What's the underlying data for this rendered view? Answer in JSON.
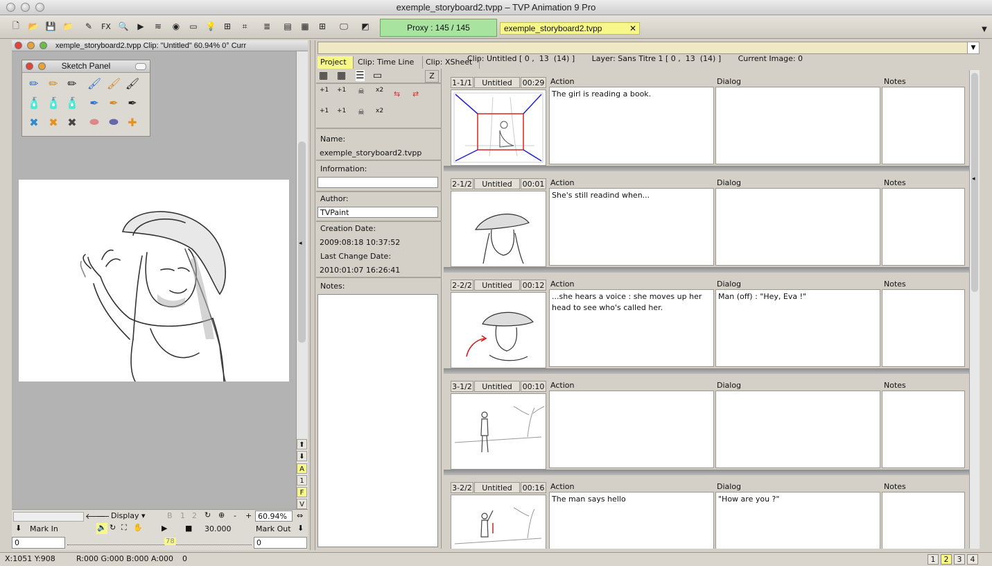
{
  "window": {
    "title": "exemple_storyboard2.tvpp – TVP Animation 9 Pro"
  },
  "toolbar": {
    "icons": [
      "new-file-icon",
      "open-folder-icon",
      "save-icon",
      "folder-icon",
      "brushes-icon",
      "fx-icon",
      "zoom-icon",
      "play-icon",
      "layers-icon",
      "color-wheel-icon",
      "palette-icon",
      "light-icon",
      "grid-icon",
      "crop-icon",
      "layer-stack-icon",
      "view1-icon",
      "view2-icon",
      "view3-icon",
      "monitor-icon",
      "gradient-icon"
    ],
    "fx_label": "FX",
    "proxy_label": "Proxy : 145 / 145",
    "doc_tab": "exemple_storyboard2.tvpp",
    "doc_tab_close": "✕"
  },
  "left_window": {
    "header": "xemple_storyboard2.tvpp  Clip: \"Untitled\"   60.94%   0°  Curr",
    "sketch_panel_title": "Sketch Panel",
    "display_select": "Display",
    "zoom_value": "60.94%",
    "fps_value": "30.000",
    "mark_in_label": "Mark In",
    "mark_out_label": "Mark Out",
    "mark_in_value": "0",
    "mark_out_value": "0",
    "slider_value": "78",
    "zoom_minus": "-",
    "zoom_plus": "+",
    "side_buttons": [
      "A",
      "1",
      "F",
      "V"
    ],
    "light_buttons": [
      "B",
      "1",
      "2"
    ]
  },
  "status_bar": {
    "coords": "X:1051  Y:908",
    "color": "R:000 G:000 B:000 A:000",
    "extra": "0",
    "pages": [
      "1",
      "2",
      "3",
      "4"
    ],
    "active_page": "2"
  },
  "project": {
    "header": "Clip: Untitled [ 0 ,  13  (14) ]       Layer: Sans Titre 1 [ 0 ,  13  (14) ]       Current Image: 0",
    "tabs": [
      "Project",
      "Clip: Time Line",
      "Clip: XSheet"
    ],
    "z_button": "Z",
    "name_label": "Name:",
    "name_value": "exemple_storyboard2.tvpp",
    "information_label": "Information:",
    "information_value": "",
    "author_label": "Author:",
    "author_value": "TVPaint",
    "creation_label": "Creation Date:",
    "creation_value": "2009:08:18 10:37:52",
    "change_label": "Last Change Date:",
    "change_value": "2010:01:07 16:26:41",
    "notes_label": "Notes:",
    "notes_value": "",
    "plus1": "+1",
    "x2": "x2"
  },
  "storyboard": {
    "col_action": "Action",
    "col_dialog": "Dialog",
    "col_notes": "Notes",
    "rows": [
      {
        "id": "1-1/1",
        "title": "Untitled",
        "time": "00:29",
        "action": "The girl is reading a book.",
        "dialog": "",
        "notes": ""
      },
      {
        "id": "2-1/2",
        "title": "Untitled",
        "time": "00:01",
        "action": "She's still readind when...",
        "dialog": "",
        "notes": ""
      },
      {
        "id": "2-2/2",
        "title": "Untitled",
        "time": "00:12",
        "action": "...she hears a voice : she moves up her head to see who's called her.",
        "dialog": "Man (off) : \"Hey, Eva !\"",
        "notes": ""
      },
      {
        "id": "3-1/2",
        "title": "Untitled",
        "time": "00:10",
        "action": "",
        "dialog": "",
        "notes": ""
      },
      {
        "id": "3-2/2",
        "title": "Untitled",
        "time": "00:16",
        "action": "The man says hello",
        "dialog": "\"How are you ?\"",
        "notes": ""
      }
    ]
  },
  "colors": {
    "proxy": "#a8e4a0",
    "doc_tab": "#f7f78a",
    "active_tab": "#f7f78a",
    "header_bar": "#efe8c2"
  }
}
